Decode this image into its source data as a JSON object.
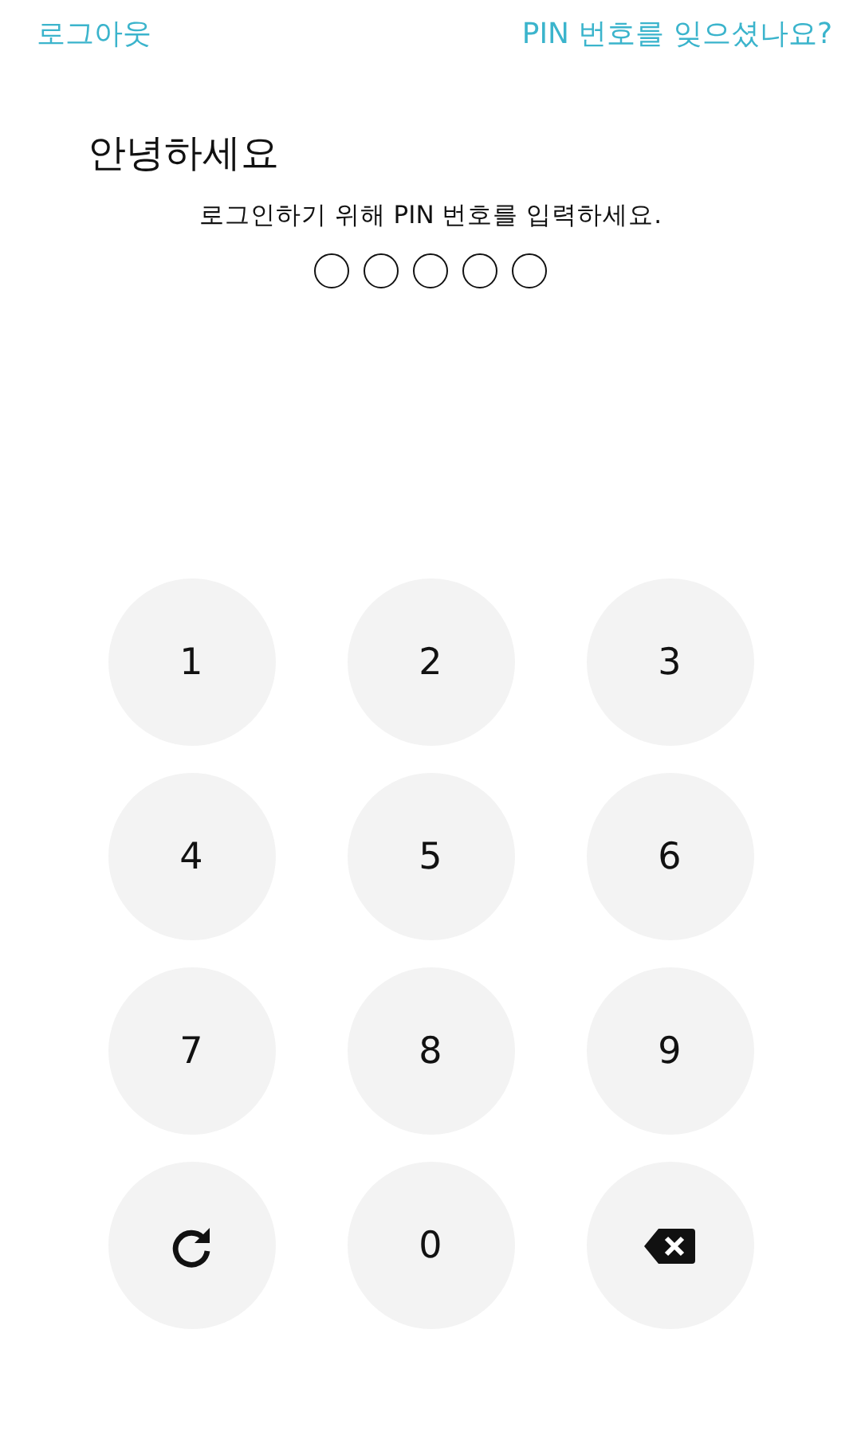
{
  "top_bar": {
    "logout_link": "로그아웃",
    "forgot_pin_link": "PIN 번호를 잊으셨나요?"
  },
  "greeting": "안녕하세요",
  "instruction": "로그인하기 위해 PIN 번호를 입력하세요.",
  "pin_dots": [
    {
      "filled": false
    },
    {
      "filled": false
    },
    {
      "filled": false
    },
    {
      "filled": false
    },
    {
      "filled": false
    }
  ],
  "keypad": [
    {
      "kind": "digit",
      "label": "1"
    },
    {
      "kind": "digit",
      "label": "2"
    },
    {
      "kind": "digit",
      "label": "3"
    },
    {
      "kind": "digit",
      "label": "4"
    },
    {
      "kind": "digit",
      "label": "5"
    },
    {
      "kind": "digit",
      "label": "6"
    },
    {
      "kind": "digit",
      "label": "7"
    },
    {
      "kind": "digit",
      "label": "8"
    },
    {
      "kind": "digit",
      "label": "9"
    },
    {
      "kind": "refresh"
    },
    {
      "kind": "digit",
      "label": "0"
    },
    {
      "kind": "backspace"
    }
  ]
}
